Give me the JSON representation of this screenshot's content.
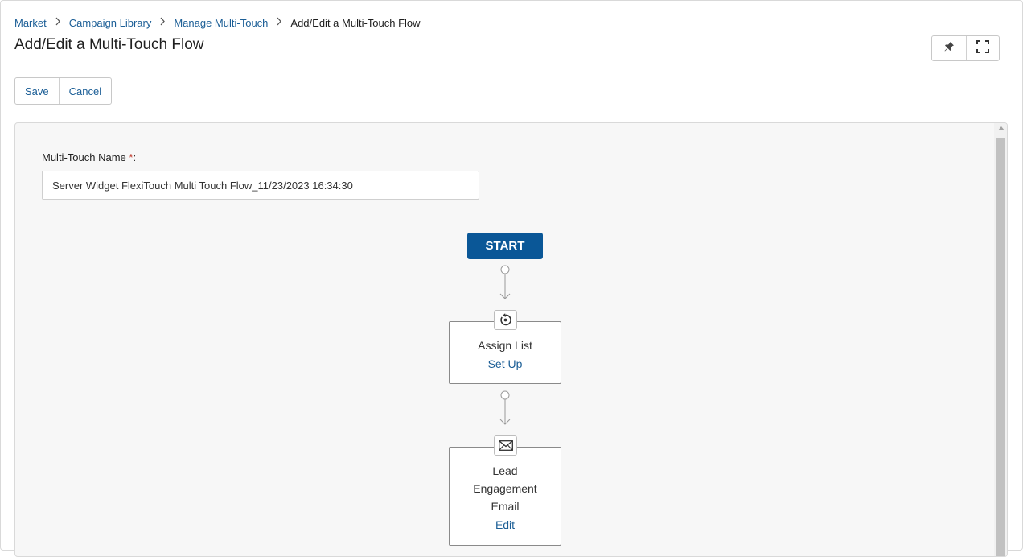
{
  "breadcrumb": {
    "items": [
      "Market",
      "Campaign Library",
      "Manage Multi-Touch"
    ],
    "current": "Add/Edit a Multi-Touch Flow"
  },
  "page_title": "Add/Edit a Multi-Touch Flow",
  "toolbar": {
    "save_label": "Save",
    "cancel_label": "Cancel",
    "pin_icon": "pin-icon",
    "expand_icon": "fullscreen-icon"
  },
  "form": {
    "name_label": "Multi-Touch Name",
    "required_mark": "*",
    "label_suffix": ":",
    "name_value": "Server Widget FlexiTouch Multi Touch Flow_11/23/2023 16:34:30"
  },
  "flow": {
    "start_label": "START",
    "nodes": [
      {
        "icon": "refresh-icon",
        "title_lines": [
          "Assign List"
        ],
        "link": "Set Up"
      },
      {
        "icon": "envelope-icon",
        "title_lines": [
          "Lead",
          "Engagement",
          "Email"
        ],
        "link": "Edit"
      }
    ]
  },
  "colors": {
    "link": "#1b5e96",
    "primary": "#0a5797",
    "required": "#c0392b"
  }
}
